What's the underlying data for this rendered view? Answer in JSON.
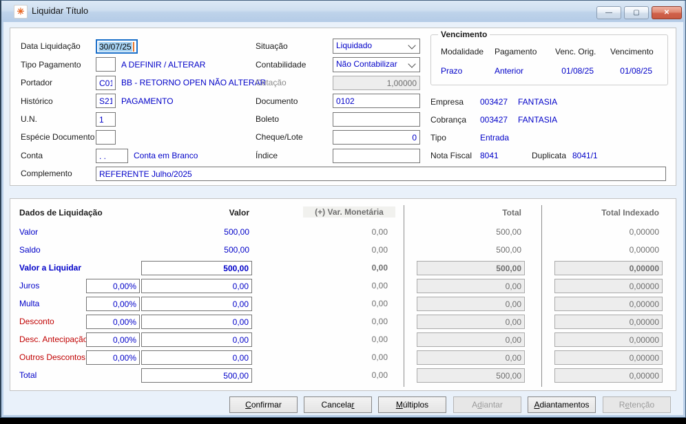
{
  "window": {
    "title": "Liquidar Título",
    "icons": {
      "app": "✳",
      "minimize": "—",
      "maximize": "▢",
      "close": "✕",
      "chevron": ""
    }
  },
  "colors": {
    "value_blue": "#0000c8",
    "label_red": "#c00000",
    "disabled_gray": "#6e6e6e",
    "focus_blue": "#1a6fc9",
    "close_red": "#c85a42"
  },
  "form": {
    "data_liquidacao": {
      "label": "Data Liquidação",
      "value": "30/07/25"
    },
    "tipo_pagamento": {
      "label": "Tipo Pagamento",
      "value": "",
      "desc": "A DEFINIR / ALTERAR"
    },
    "portador": {
      "label": "Portador",
      "value": "C01",
      "desc": "BB - RETORNO OPEN NÃO ALTERAR"
    },
    "historico": {
      "label": "Histórico",
      "value": "S21",
      "desc": "PAGAMENTO"
    },
    "un": {
      "label": "U.N.",
      "value": "1"
    },
    "especie": {
      "label": "Espécie Documento",
      "value": ""
    },
    "conta": {
      "label": "Conta",
      "value": ". .",
      "desc": "Conta em Branco"
    },
    "complemento": {
      "label": "Complemento",
      "value": "REFERENTE Julho/2025"
    },
    "situacao": {
      "label": "Situação",
      "value": "Liquidado"
    },
    "contabilidade": {
      "label": "Contabilidade",
      "value": "Não Contabilizar"
    },
    "cotacao": {
      "label": "Cotação",
      "value": "1,00000"
    },
    "documento": {
      "label": "Documento",
      "value": "0102"
    },
    "boleto": {
      "label": "Boleto",
      "value": ""
    },
    "cheque_lote": {
      "label": "Cheque/Lote",
      "value": "0"
    },
    "indice": {
      "label": "Índice",
      "value": ""
    }
  },
  "vencimento": {
    "title": "Vencimento",
    "headers": [
      "Modalidade",
      "Pagamento",
      "Venc. Orig.",
      "Vencimento"
    ],
    "values": [
      "Prazo",
      "Anterior",
      "01/08/25",
      "01/08/25"
    ]
  },
  "titulo": {
    "empresa": {
      "label": "Empresa",
      "code": "003427",
      "name": "FANTASIA"
    },
    "cobranca": {
      "label": "Cobrança",
      "code": "003427",
      "name": "FANTASIA"
    },
    "tipo": {
      "label": "Tipo",
      "value": "Entrada"
    },
    "nota_fiscal": {
      "label": "Nota Fiscal",
      "value": "8041"
    },
    "duplicata": {
      "label": "Duplicata",
      "value": "8041/1"
    }
  },
  "grid": {
    "section_title": "Dados de Liquidação",
    "headers": {
      "valor": "Valor",
      "var": "(+) Var. Monetária",
      "total": "Total",
      "indexado": "Total Indexado"
    },
    "rows": [
      {
        "label": "Valor",
        "valor": "500,00",
        "var": "0,00",
        "total": "500,00",
        "indexado": "0,00000"
      },
      {
        "label": "Saldo",
        "valor": "500,00",
        "var": "0,00",
        "total": "500,00",
        "indexado": "0,00000"
      },
      {
        "label": "Valor a Liquidar",
        "valor": "500,00",
        "var": "0,00",
        "total": "500,00",
        "indexado": "0,00000"
      },
      {
        "label": "Juros",
        "pct": "0,00%",
        "valor": "0,00",
        "var": "0,00",
        "total": "0,00",
        "indexado": "0,00000"
      },
      {
        "label": "Multa",
        "pct": "0,00%",
        "valor": "0,00",
        "var": "0,00",
        "total": "0,00",
        "indexado": "0,00000"
      },
      {
        "label": "Desconto",
        "pct": "0,00%",
        "valor": "0,00",
        "var": "0,00",
        "total": "0,00",
        "indexado": "0,00000"
      },
      {
        "label": "Desc. Antecipação",
        "pct": "0,00%",
        "valor": "0,00",
        "var": "0,00",
        "total": "0,00",
        "indexado": "0,00000"
      },
      {
        "label": "Outros Descontos",
        "pct": "0,00%",
        "valor": "0,00",
        "var": "0,00",
        "total": "0,00",
        "indexado": "0,00000"
      },
      {
        "label": "Total",
        "valor": "500,00",
        "var": "0,00",
        "total": "500,00",
        "indexado": "0,00000"
      }
    ]
  },
  "buttons": [
    {
      "pre": "",
      "key": "C",
      "post": "onfirmar"
    },
    {
      "pre": "Cancela",
      "key": "r",
      "post": ""
    },
    {
      "pre": "",
      "key": "M",
      "post": "últiplos"
    },
    {
      "pre": "A",
      "key": "d",
      "post": "iantar"
    },
    {
      "pre": "",
      "key": "A",
      "post": "diantamentos"
    },
    {
      "pre": "R",
      "key": "e",
      "post": "tenção"
    }
  ]
}
